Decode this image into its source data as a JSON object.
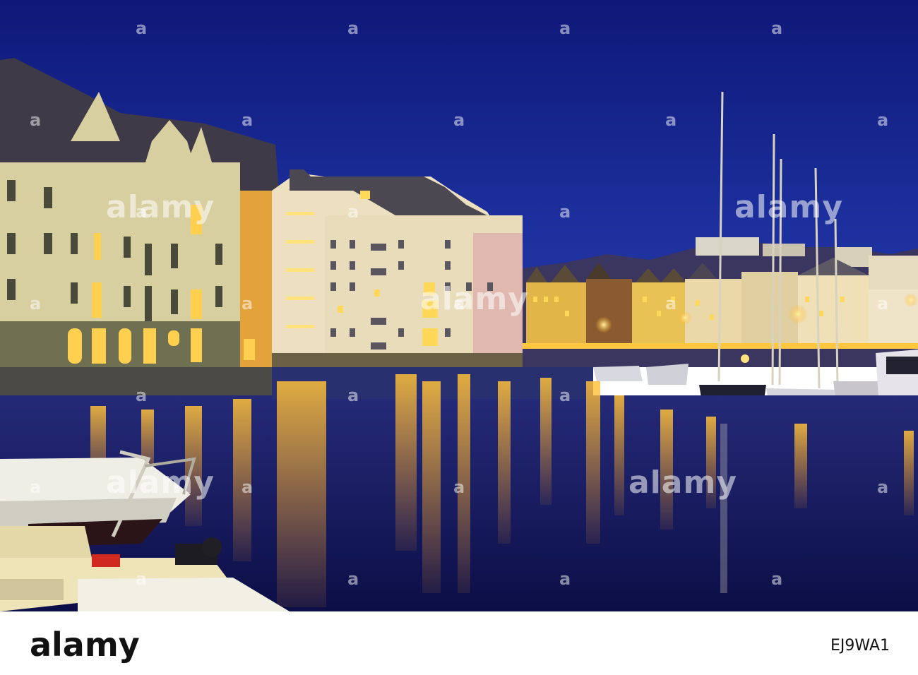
{
  "watermark": {
    "brand": "alamy",
    "mark": "a"
  },
  "footer": {
    "logo": "alamy",
    "image_id": "EJ9WA1"
  },
  "colors": {
    "sky": "#1c2a8a",
    "water": "#10124a",
    "light": "#ffc23a",
    "facade_cream": "#d8cfa0",
    "facade_orange": "#e3a23a"
  }
}
